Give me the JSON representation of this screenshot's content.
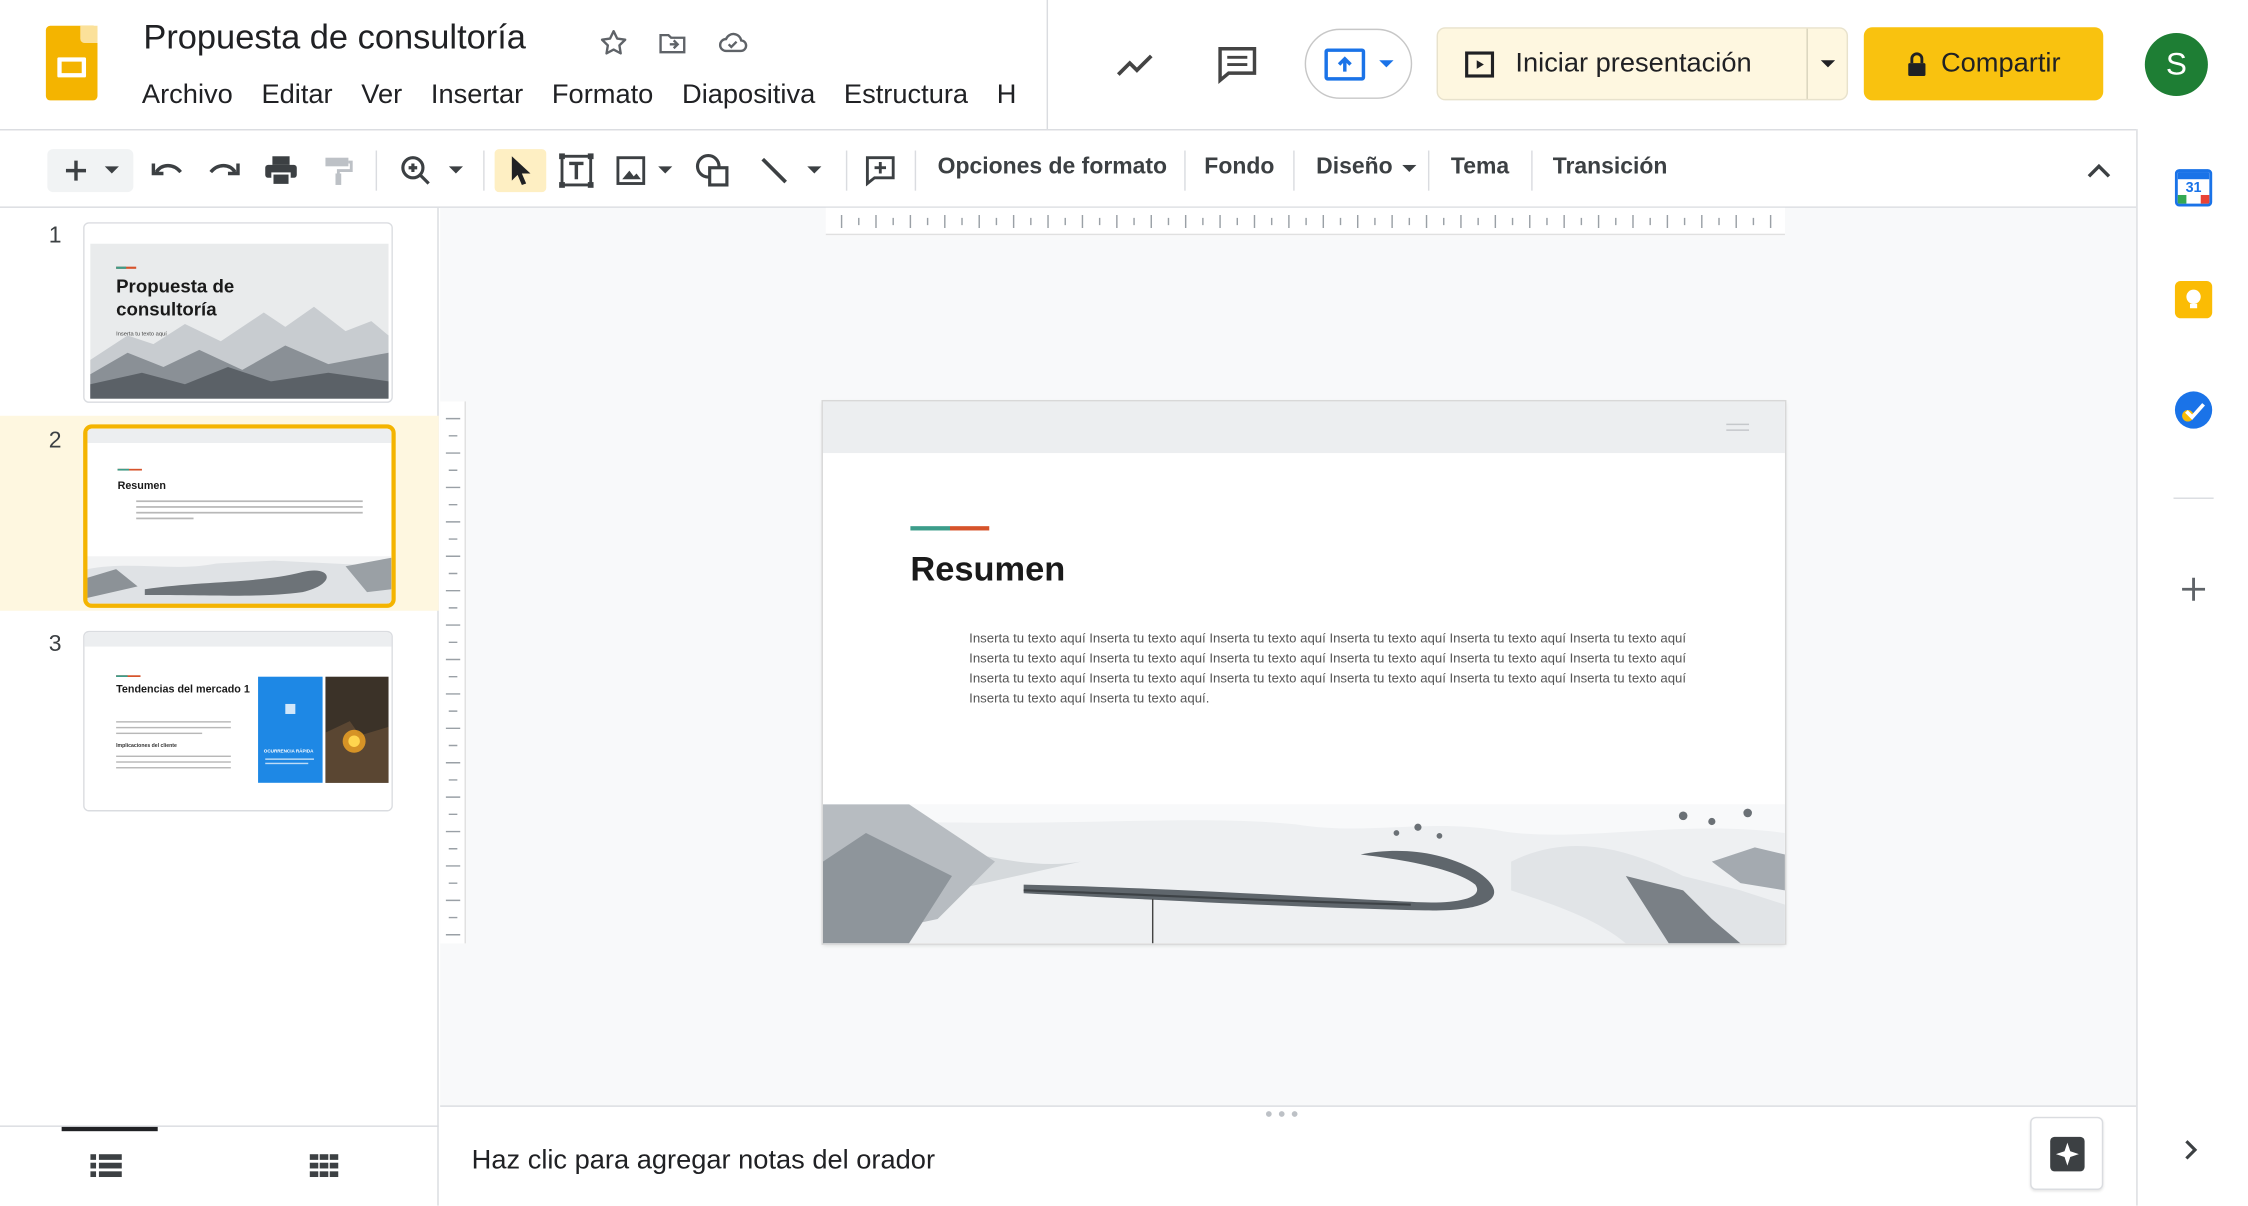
{
  "app": {
    "title": "Propuesta de consultoría",
    "menu": [
      "Archivo",
      "Editar",
      "Ver",
      "Insertar",
      "Formato",
      "Diapositiva",
      "Estructura",
      "H"
    ],
    "present_label": "Iniciar presentación",
    "share_label": "Compartir",
    "avatar_letter": "S"
  },
  "toolbar": {
    "format_options": "Opciones de formato",
    "background": "Fondo",
    "layout": "Diseño",
    "theme": "Tema",
    "transition": "Transición"
  },
  "filmstrip": {
    "slides": [
      {
        "number": "1",
        "title": "Propuesta de consultoría",
        "subtitle": "Inserta tu texto aquí"
      },
      {
        "number": "2",
        "title": "Resumen"
      },
      {
        "number": "3",
        "title": "Tendencias del mercado 1",
        "subheading": "Implicaciones del cliente",
        "card_label": "OCURRENCIA RÁPIDA"
      }
    ]
  },
  "slide": {
    "title": "Resumen",
    "body": "Inserta tu texto aquí Inserta tu texto aquí Inserta tu texto aquí Inserta tu texto aquí Inserta tu texto aquí Inserta tu texto aquí Inserta tu texto aquí Inserta tu texto aquí Inserta tu texto aquí Inserta tu texto aquí Inserta tu texto aquí Inserta tu texto aquí Inserta tu texto aquí Inserta tu texto aquí Inserta tu texto aquí Inserta tu texto aquí Inserta tu texto aquí Inserta tu texto aquí Inserta tu texto aquí Inserta tu texto aquí."
  },
  "notes": {
    "placeholder": "Haz clic para agregar notas del orador"
  },
  "side_panel": {
    "calendar_day": "31"
  },
  "colors": {
    "accent_yellow": "#f4b400",
    "share_yellow": "#f9c20f",
    "accent_teal": "#3c9d8a",
    "accent_orange": "#d6532b",
    "avatar_green": "#1e7e34"
  }
}
